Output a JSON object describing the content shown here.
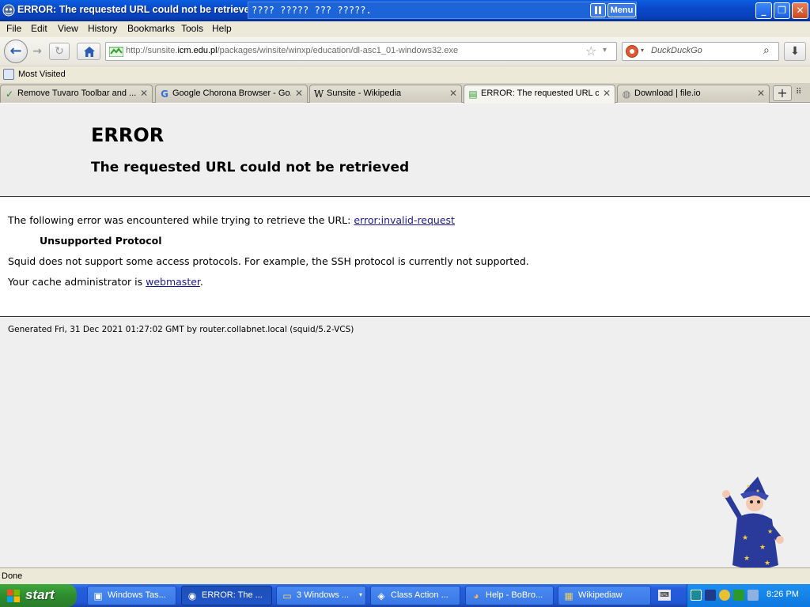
{
  "window": {
    "title": "ERROR: The requested URL could not be retrieved - Mozilla Firefox",
    "overlay_text": "???? ????? ??? ?????.",
    "overlay_menu": "Menu",
    "min_glyph": "_",
    "max_glyph": "❐",
    "close_glyph": "✕"
  },
  "menubar": {
    "items": [
      "File",
      "Edit",
      "View",
      "History",
      "Bookmarks",
      "Tools",
      "Help"
    ]
  },
  "navbar": {
    "back_glyph": "←",
    "fwd_glyph": "→",
    "reload_glyph": "↻",
    "url_prefix": "http://sunsite.",
    "url_domain": "icm.edu.pl",
    "url_path": "/packages/winsite/winxp/education/dl-asc1_01-windows32.exe",
    "star_glyph": "☆",
    "dd_glyph": "▾",
    "search_placeholder": "DuckDuckGo",
    "search_glyph": "⌕",
    "download_glyph": "⬇"
  },
  "bookmarks": {
    "label": "Most Visited"
  },
  "tabs": [
    {
      "label": "Remove Tuvaro Toolbar and ...",
      "icon": "✓",
      "icon_color": "#2e8b2e"
    },
    {
      "label": "Google Chorona Browser - Go...",
      "icon": "G",
      "icon_color": "#3a6fd8"
    },
    {
      "label": "Sunsite - Wikipedia",
      "icon": "W",
      "icon_color": "#222222"
    },
    {
      "label": "ERROR: The requested URL c...",
      "icon": "▤",
      "icon_color": "#2ea02e"
    },
    {
      "label": "Download | file.io",
      "icon": "◍",
      "icon_color": "#777777"
    }
  ],
  "tab_close_glyph": "✕",
  "new_tab_glyph": "+",
  "tab_list_glyph": "⠿",
  "page": {
    "h1": "ERROR",
    "h2": "The requested URL could not be retrieved",
    "line1_prefix": "The following error was encountered while trying to retrieve the URL: ",
    "line1_link": "error:invalid-request",
    "proto": "Unsupported Protocol",
    "line2": "Squid does not support some access protocols. For example, the SSH protocol is currently not supported.",
    "line3_prefix": "Your cache administrator is ",
    "line3_link": "webmaster",
    "line3_suffix": ".",
    "footer": "Generated Fri, 31 Dec 2021 01:27:02 GMT by router.collabnet.local (squid/5.2-VCS)"
  },
  "statusbar": {
    "text": "Done"
  },
  "taskbar": {
    "start_label": "start",
    "tasks": [
      {
        "label": "Windows Tas...",
        "icon": "▣",
        "active": false,
        "dropdown": false
      },
      {
        "label": "ERROR: The ...",
        "icon": "◉",
        "active": true,
        "dropdown": false
      },
      {
        "label": "3 Windows ...",
        "icon": "▭",
        "active": false,
        "dropdown": true
      },
      {
        "label": "Class Action ...",
        "icon": "◈",
        "active": false,
        "dropdown": false
      },
      {
        "label": "Help - BoBro...",
        "icon": "◕",
        "active": false,
        "dropdown": false
      },
      {
        "label": "Wikipediaw",
        "icon": "▦",
        "active": false,
        "dropdown": false
      }
    ],
    "task_dd_glyph": "▾",
    "kbd_label": "⌨",
    "clock": "8:26 PM"
  },
  "colors": {
    "link": "#1a1a8c",
    "titlebar": "#0a48c8",
    "taskbar": "#245edb",
    "start": "#2e8c2e"
  }
}
